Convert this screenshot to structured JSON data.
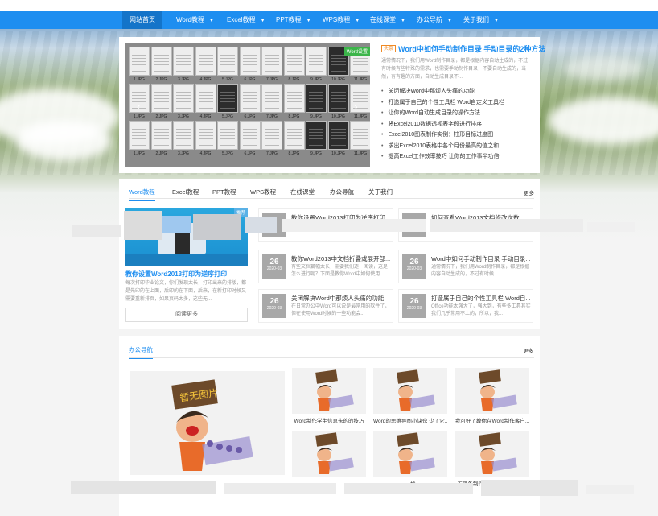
{
  "nav": {
    "items": [
      {
        "label": "网站首页",
        "caret": false
      },
      {
        "label": "Word教程",
        "caret": true
      },
      {
        "label": "Excel教程",
        "caret": true
      },
      {
        "label": "PPT教程",
        "caret": true
      },
      {
        "label": "WPS教程",
        "caret": true
      },
      {
        "label": "在线课堂",
        "caret": true
      },
      {
        "label": "办公导航",
        "caret": true
      },
      {
        "label": "关于我们",
        "caret": true
      }
    ],
    "caret_glyph": "▼"
  },
  "slider": {
    "badge": "Word设置",
    "prev": "‹",
    "next": "›",
    "thumb_labels": [
      "1.JPG",
      "2.JPG",
      "3.JPG",
      "4.JPG",
      "5.JPG",
      "6.JPG",
      "7.JPG",
      "8.JPG",
      "9.JPG",
      "10.JPG",
      "11.JPG"
    ]
  },
  "hero": {
    "badge": "头条",
    "title": "Word中如何手动制作目录 手动目录的2种方法",
    "desc": "通常情况下，我们用Word制作目录，都是根据内容自动生成的，不过有时候有些特殊的需求，也需要手动制作目录，不要自动生成的，当然，有有趣的方面，自动生成目录不...",
    "list": [
      "关闭解决Word中那烦人头痛的功能",
      "打造属于自己的个性工具栏 Word自定义工具栏",
      "让你的Word自动生成目录的操作方法",
      "将Excel2010数据透视表字段进行排序",
      "Excel2010图表制作实例：柱形目标进度图",
      "求出Excel2010表格中各个月份最高的值之和",
      "提高Excel工作效率技巧 让你的工作事半功倍"
    ]
  },
  "tabs": {
    "items": [
      "Word教程",
      "Excel教程",
      "PPT教程",
      "WPS教程",
      "在线课堂",
      "办公导航",
      "关于我们"
    ],
    "more": "更多"
  },
  "feature": {
    "tag": "推荐",
    "title": "教你设置Word2013打印为逆序打印",
    "desc": "每次打印毕业论文，你们发现太长，打印出来的排版，都是先印的在上面，后印的在下面，后来，在新打印时候又需要重新排页，如果页码太多，这些无...",
    "read_more": "阅读更多"
  },
  "articles": [
    {
      "title": "教你设置Word2013打印为逆序打印",
      "desc": "",
      "day": "",
      "date": ""
    },
    {
      "title": "如何查看Word2013文档修改次数",
      "desc": "",
      "day": "",
      "date": ""
    },
    {
      "title": "教你Word2013中文档折叠或展开部...",
      "desc": "有些文档篇幅太长，需要我们逐一阅读，这是怎么进行呢？下面是教你Word中如何使用...",
      "day": "26",
      "date": "2020-03"
    },
    {
      "title": "Word中如何手动制作目录 手动目录...",
      "desc": "通常情况下，我们用Word制作目录，都是根据内容自动生成的，不过有时候...",
      "day": "26",
      "date": "2020-03"
    },
    {
      "title": "关闭解决Word中那烦人头痛的功能",
      "desc": "在日常办公中Word可以说是最常用的软件了，但在使用Word时候的一些功能会...",
      "day": "26",
      "date": "2020-03"
    },
    {
      "title": "打造属于自己的个性工具栏 Word自...",
      "desc": "Office功能太强大了，强大到，有些多工具其实我们几乎常用不上的，所以，我...",
      "day": "26",
      "date": "2020-03"
    }
  ],
  "office": {
    "title": "办公导航",
    "more": "更多",
    "no_image_text": "暂无图片",
    "grid_captions": [
      "Word制作学生信息卡的的技巧",
      "Word的思维导图小诀窍 少了它...",
      "我可好了教你在Word制作客户...",
      "",
      "...一步...",
      "工资条制作方法(超详细)在W..."
    ]
  }
}
